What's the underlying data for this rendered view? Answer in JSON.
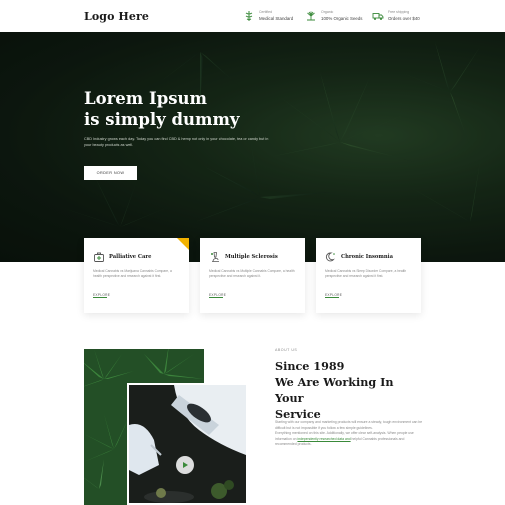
{
  "header": {
    "logo": "Logo Here",
    "features": [
      {
        "icon": "caduceus-icon",
        "small": "Certified",
        "label": "Medical Standard"
      },
      {
        "icon": "leaf-icon",
        "small": "Organic",
        "label": "100% Organic Seeds"
      },
      {
        "icon": "truck-icon",
        "small": "Free shipping",
        "label": "Orders over $40"
      }
    ]
  },
  "hero": {
    "title_line1": "Lorem Ipsum",
    "title_line2": "is simply dummy",
    "subtitle": "CBD Industry grows each day. Today you can find CBD & hemp not only in your chocolate, tea or candy but in your beauty products as well.",
    "button": "ORDER NOW"
  },
  "cards": [
    {
      "icon": "first-aid-kit-icon",
      "title": "Palliative Care",
      "desc": "Medical Cannabis vs Marijuana Cannabis Compare, a health perspective and research against it first.",
      "link": "EXPLORE"
    },
    {
      "icon": "microscope-icon",
      "title": "Multiple Sclerosis",
      "desc": "Medical Cannabis vs Multiple Cannabis Compare, a health perspective and research against it.",
      "link": "EXPLORE"
    },
    {
      "icon": "moon-icon",
      "title": "Chronic Insomnia",
      "desc": "Medical Cannabis vs Sleep Disorder Compare, a health perspective and research against it first.",
      "link": "EXPLORE"
    }
  ],
  "about": {
    "eyebrow": "ABOUT US",
    "title_line1": "Since 1989",
    "title_line2": "We Are Working In Your",
    "title_line3": "Service",
    "p1": "Starting with our company and marketing products will ensure a steady, tough environment can be difficult but is not impossible if you follow a few simple guidelines.",
    "p2_before": "Everything mentioned on this site. Additionally, we offer clear self-analysis. When people use information on ",
    "p2_link": "independently researched data and",
    "p2_after": " helpful Cannabis professionals and recommended products.",
    "play_icon": "play-icon"
  },
  "colors": {
    "accent_green": "#3a8a3a",
    "badge_yellow": "#f2b200",
    "hero_dark": "#0f1a10"
  }
}
